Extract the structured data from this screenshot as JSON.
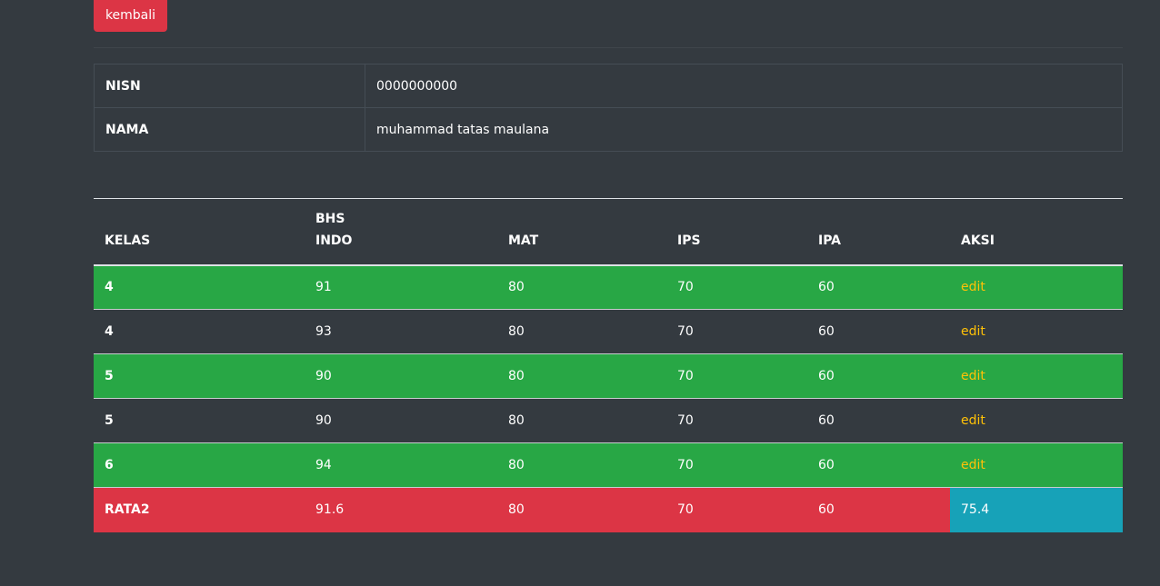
{
  "header": {
    "back_label": "kembali"
  },
  "student": {
    "rows": [
      {
        "key": "NISN",
        "value": "0000000000"
      },
      {
        "key": "NAMA",
        "value": "muhammad tatas maulana"
      }
    ]
  },
  "grades": {
    "columns": [
      "KELAS",
      "BHS INDO",
      "MAT",
      "IPS",
      "IPA",
      "AKSI"
    ],
    "rows": [
      {
        "kelas": "4",
        "bhs_indo": "91",
        "mat": "80",
        "ips": "70",
        "ipa": "60",
        "aksi": "edit"
      },
      {
        "kelas": "4",
        "bhs_indo": "93",
        "mat": "80",
        "ips": "70",
        "ipa": "60",
        "aksi": "edit"
      },
      {
        "kelas": "5",
        "bhs_indo": "90",
        "mat": "80",
        "ips": "70",
        "ipa": "60",
        "aksi": "edit"
      },
      {
        "kelas": "5",
        "bhs_indo": "90",
        "mat": "80",
        "ips": "70",
        "ipa": "60",
        "aksi": "edit"
      },
      {
        "kelas": "6",
        "bhs_indo": "94",
        "mat": "80",
        "ips": "70",
        "ipa": "60",
        "aksi": "edit"
      }
    ],
    "average": {
      "label": "RATA2",
      "bhs_indo": "91.6",
      "mat": "80",
      "ips": "70",
      "ipa": "60",
      "overall": "75.4"
    }
  },
  "colors": {
    "background": "#343a40",
    "danger": "#dc3545",
    "success": "#28a745",
    "info": "#17a2b8",
    "warning": "#ffc107"
  }
}
